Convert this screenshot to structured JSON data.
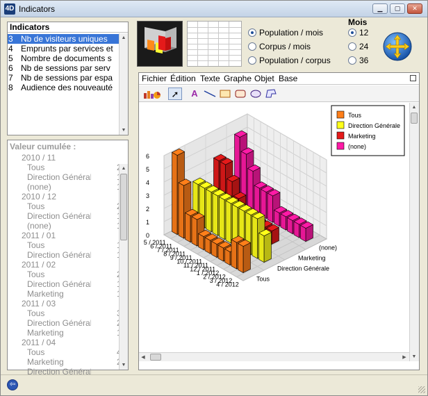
{
  "window": {
    "title": "Indicators"
  },
  "indicators": {
    "header": "Indicators",
    "items": [
      {
        "num": "3",
        "label": "Nb de visiteurs uniques",
        "selected": true
      },
      {
        "num": "4",
        "label": "Emprunts par services et"
      },
      {
        "num": "5",
        "label": "Nombre de documents s"
      },
      {
        "num": "6",
        "label": "Nb de sessions par serv"
      },
      {
        "num": "7",
        "label": "Nb de sessions par espa"
      },
      {
        "num": "8",
        "label": "Audience des nouveauté"
      }
    ]
  },
  "cumul": {
    "header": "Valeur cumulée :",
    "rows": [
      {
        "label": "2010 / 11",
        "indent": 0,
        "value": ""
      },
      {
        "label": "Tous",
        "indent": 1,
        "value": "2"
      },
      {
        "label": "Direction Générale",
        "indent": 1,
        "value": "1"
      },
      {
        "label": "(none)",
        "indent": 1,
        "value": "1"
      },
      {
        "label": "2010 / 12",
        "indent": 0,
        "value": ""
      },
      {
        "label": "Tous",
        "indent": 1,
        "value": "2"
      },
      {
        "label": "Direction Générale",
        "indent": 1,
        "value": "1"
      },
      {
        "label": "(none)",
        "indent": 1,
        "value": "1"
      },
      {
        "label": "2011 / 01",
        "indent": 0,
        "value": ""
      },
      {
        "label": "Tous",
        "indent": 1,
        "value": "1"
      },
      {
        "label": "Direction Générale",
        "indent": 1,
        "value": "1"
      },
      {
        "label": "2011 / 02",
        "indent": 0,
        "value": ""
      },
      {
        "label": "Tous",
        "indent": 1,
        "value": "2"
      },
      {
        "label": "Direction Générale",
        "indent": 1,
        "value": "1"
      },
      {
        "label": "Marketing",
        "indent": 1,
        "value": "1"
      },
      {
        "label": "2011 / 03",
        "indent": 0,
        "value": ""
      },
      {
        "label": "Tous",
        "indent": 1,
        "value": "3"
      },
      {
        "label": "Direction Générale",
        "indent": 1,
        "value": "2"
      },
      {
        "label": "Marketing",
        "indent": 1,
        "value": "1"
      },
      {
        "label": "2011 / 04",
        "indent": 0,
        "value": ""
      },
      {
        "label": "Tous",
        "indent": 1,
        "value": "4"
      },
      {
        "label": "Marketing",
        "indent": 1,
        "value": "2"
      },
      {
        "label": "Direction Générale",
        "indent": 1,
        "value": ""
      }
    ]
  },
  "mode": {
    "options": [
      {
        "label": "Population / mois",
        "checked": true
      },
      {
        "label": "Corpus / mois",
        "checked": false
      },
      {
        "label": "Population / corpus",
        "checked": false
      }
    ]
  },
  "mois": {
    "title": "Mois",
    "options": [
      {
        "label": "12",
        "checked": true
      },
      {
        "label": "24",
        "checked": false
      },
      {
        "label": "36",
        "checked": false
      }
    ]
  },
  "graph": {
    "menu": [
      "Fichier",
      "Édition",
      "Texte",
      "Graphe",
      "Objet",
      "Base"
    ],
    "tools": [
      {
        "icon": "chart-type-icon",
        "glyph": "▥"
      },
      {
        "icon": "arrow-pointer-icon",
        "glyph": "➚"
      },
      {
        "icon": "text-tool-icon",
        "glyph": "A"
      },
      {
        "icon": "line-tool-icon",
        "glyph": "╲"
      },
      {
        "icon": "rectangle-tool-icon",
        "glyph": "▭"
      },
      {
        "icon": "rounded-rectangle-tool-icon",
        "glyph": "▢"
      },
      {
        "icon": "oval-tool-icon",
        "glyph": "◯"
      },
      {
        "icon": "polygon-tool-icon",
        "glyph": "⌓"
      }
    ]
  },
  "chart_data": {
    "type": "bar",
    "style": "3d-bar",
    "x_categories": [
      "5 / 2011",
      "6 / 2011",
      "7 / 2011",
      "8 / 2011",
      "9 / 2011",
      "10 / 2011",
      "11 / 2011",
      "12 / 2011",
      "1 / 2012",
      "2 / 2012",
      "3 / 2012",
      "4 / 2012"
    ],
    "series": [
      {
        "name": "Tous",
        "color": "#ff7f1a",
        "values": [
          6,
          4,
          2,
          2,
          1,
          1,
          1,
          1,
          1,
          2,
          2,
          0
        ]
      },
      {
        "name": "Direction Générale",
        "color": "#ffff1a",
        "values": [
          3,
          3,
          3,
          3,
          3,
          3,
          3,
          3,
          3,
          3,
          2,
          0
        ]
      },
      {
        "name": "Marketing",
        "color": "#e51a1a",
        "values": [
          4,
          4,
          3,
          2,
          1,
          1,
          1,
          1,
          1,
          0,
          0,
          0
        ]
      },
      {
        "name": "(none)",
        "color": "#ff1aa6",
        "values": [
          5,
          4,
          3,
          2,
          2,
          2,
          1,
          1,
          1,
          1,
          1,
          0
        ]
      }
    ],
    "z_categories": [
      "Tous",
      "Direction Générale",
      "Marketing",
      "(none)"
    ],
    "ylim": [
      0,
      6
    ],
    "yticks": [
      "0",
      "1",
      "2",
      "3",
      "4",
      "5",
      "6"
    ],
    "legend": "top-right",
    "grid": true
  }
}
